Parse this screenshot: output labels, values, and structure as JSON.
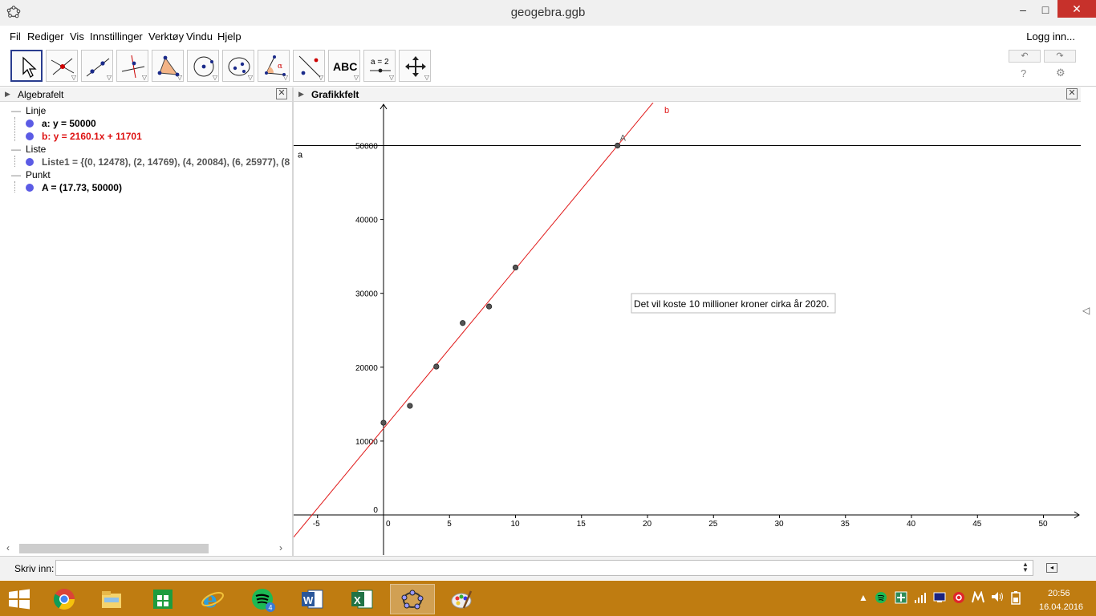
{
  "window": {
    "title": "geogebra.ggb",
    "min": "‒",
    "max": "□",
    "close": "✕"
  },
  "menu": {
    "items": [
      "Fil",
      "Rediger",
      "Vis",
      "Innstillinger",
      "Verktøy",
      "Vindu",
      "Hjelp"
    ],
    "login": "Logg inn..."
  },
  "toolbar": {
    "tools": [
      "move-tool",
      "point-tool",
      "line-tool",
      "perpendicular-tool",
      "polygon-tool",
      "circle-tool",
      "conic-tool",
      "angle-tool",
      "reflect-tool",
      "text-tool",
      "slider-tool",
      "move-graphics-tool"
    ],
    "text_tool_label": "ABC",
    "slider_tool_label": "a = 2",
    "undo": "↶",
    "redo": "↷",
    "help": "?",
    "settings": "⚙"
  },
  "algebra": {
    "title": "Algebrafelt",
    "categories": [
      {
        "label": "Linje",
        "items": [
          {
            "text": "a: y = 50000",
            "color": "black"
          },
          {
            "text": "b: y = 2160.1x + 11701",
            "color": "red"
          }
        ]
      },
      {
        "label": "Liste",
        "items": [
          {
            "text": "Liste1 = {(0, 12478), (2, 14769), (4, 20084), (6, 25977), (8",
            "color": "gray"
          }
        ]
      },
      {
        "label": "Punkt",
        "items": [
          {
            "text": "A = (17.73, 50000)",
            "color": "black"
          }
        ]
      }
    ]
  },
  "graphics": {
    "title": "Grafikkfelt",
    "line_a_label": "a",
    "line_b_label": "b",
    "point_A_label": "A",
    "textbox": "Det vil koste 10 millioner kroner cirka år 2020.",
    "x_ticks": [
      -5,
      0,
      5,
      10,
      15,
      20,
      25,
      30,
      35,
      40,
      45,
      50
    ],
    "y_ticks": [
      0,
      10000,
      20000,
      30000,
      40000,
      50000
    ],
    "list_points": [
      [
        0,
        12478
      ],
      [
        2,
        14769
      ],
      [
        4,
        20084
      ],
      [
        6,
        25977
      ],
      [
        8,
        28216
      ],
      [
        10,
        33493
      ]
    ],
    "line_b": {
      "slope": 2160.1,
      "intercept": 11701
    },
    "line_a": {
      "y": 50000
    },
    "point_A": [
      17.73,
      50000
    ],
    "colors": {
      "line_b": "#e01818",
      "axis": "#000000",
      "point": "#555555"
    }
  },
  "input": {
    "label": "Skriv inn:"
  },
  "taskbar": {
    "apps": [
      "chrome-icon",
      "file-explorer-icon",
      "store-icon",
      "internet-explorer-icon",
      "spotify-icon",
      "word-icon",
      "excel-icon",
      "geogebra-icon",
      "paint-icon"
    ],
    "spotify_badge": "4",
    "time": "20:56",
    "date": "16.04.2016"
  }
}
